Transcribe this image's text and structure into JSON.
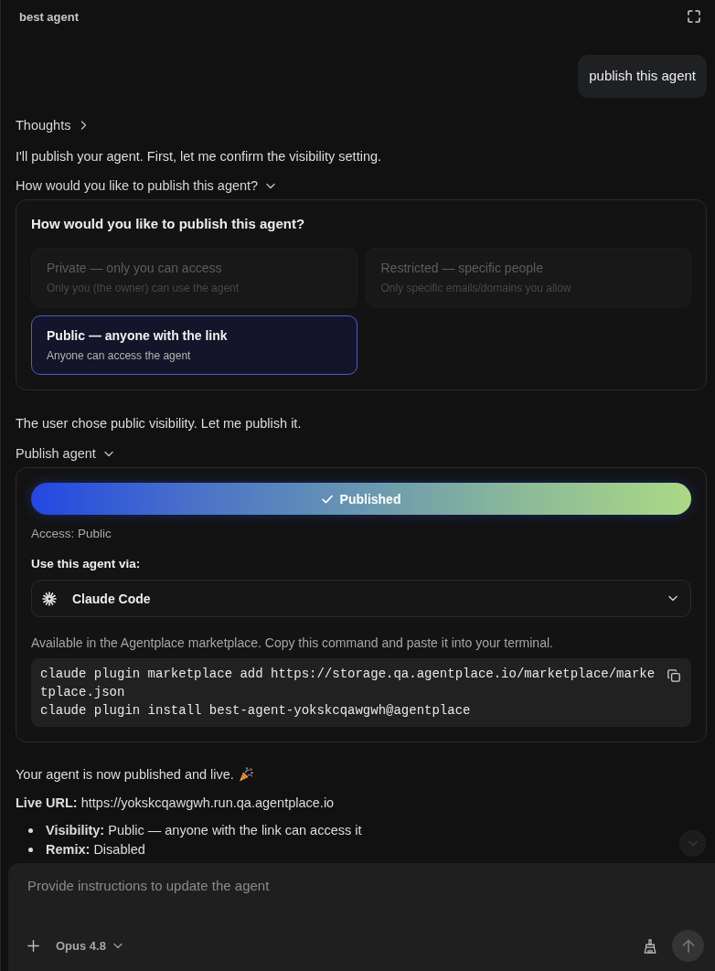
{
  "header": {
    "title": "best agent"
  },
  "messages": [
    {
      "kind": "user",
      "text": "publish this agent"
    },
    {
      "kind": "thoughts",
      "label": "Thoughts",
      "expanded": false
    },
    {
      "kind": "text",
      "text": "I'll publish your agent. First, let me confirm the visibility setting."
    },
    {
      "kind": "question",
      "label": "How would you like to publish this agent?",
      "expanded": true,
      "card": {
        "title": "How would you like to publish this agent?",
        "options": [
          {
            "title": "Private — only you can access",
            "description": "Only you (the owner) can use the agent",
            "selected": false
          },
          {
            "title": "Restricted — specific people",
            "description": "Only specific emails/domains you allow",
            "selected": false
          },
          {
            "title": "Public — anyone with the link",
            "description": "Anyone can access the agent",
            "selected": true
          }
        ]
      }
    },
    {
      "kind": "text",
      "text": "The user chose public visibility. Let me publish it."
    },
    {
      "kind": "publish",
      "label": "Publish agent",
      "expanded": true,
      "card": {
        "status": "Published",
        "access": "Access: Public",
        "use_via_label": "Use this agent via:",
        "client": "Claude Code",
        "instructions": "Available in the Agentplace marketplace. Copy this command and paste it into your terminal.",
        "command_lines": [
          "claude plugin marketplace add https://storage.qa.agentplace.io/marketplace/marketplace.json",
          "claude plugin install best-agent-yokskcqawgwh@agentplace"
        ]
      }
    },
    {
      "kind": "result",
      "headline": "Your agent is now published and live.",
      "url_line": "**Live URL:** https://yokskcqawgwh.run.qa.agentplace.io",
      "bullets": [
        "**Visibility:** Public — anyone with the link can access it",
        "**Remix:** Disabled"
      ]
    }
  ],
  "composer": {
    "placeholder": "Provide instructions to update the agent",
    "model": "Opus 4.8"
  }
}
